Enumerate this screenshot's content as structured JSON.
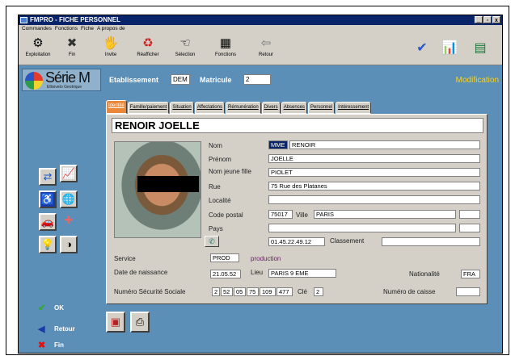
{
  "window": {
    "title": "FMPRO - FICHE PERSONNEL",
    "controls": [
      "_",
      "▫",
      "x"
    ]
  },
  "menu": [
    "Commandes",
    "Fonctions",
    "Fiche",
    "A propos de"
  ],
  "toolbar": {
    "buttons": [
      {
        "label": "Exploitation",
        "icon": "exploitation-icon",
        "glyph": "⚙"
      },
      {
        "label": "Fin",
        "icon": "fin-icon",
        "glyph": "✖"
      },
      {
        "label": "Invite",
        "icon": "invite-icon",
        "glyph": "🖐"
      },
      {
        "label": "Réafficher",
        "icon": "refresh-icon",
        "glyph": "♻"
      },
      {
        "label": "Sélection",
        "icon": "selection-icon",
        "glyph": "☜"
      },
      {
        "label": "Fonctions",
        "icon": "functions-icon",
        "glyph": "▦"
      },
      {
        "label": "Retour",
        "icon": "back-icon",
        "glyph": "⇦"
      }
    ],
    "right_icons": [
      {
        "icon": "check-tool-icon",
        "glyph": "✔"
      },
      {
        "icon": "presentation-icon",
        "glyph": "📊"
      },
      {
        "icon": "calculator-icon",
        "glyph": "▤"
      }
    ]
  },
  "header": {
    "app_title": "Série M",
    "app_subtitle": "Ellisiveto Geotrique",
    "etablissement_label": "Etablissement",
    "etablissement_value": "DEM",
    "matricule_label": "Matricule",
    "matricule_value": "2",
    "mode": "Modification"
  },
  "side": {
    "grid_icons": [
      "person-transfer-icon",
      "chart-icon",
      "accessibility-icon",
      "globe-icon",
      "car-icon",
      "medical-cross-icon",
      "lightbulb-icon",
      "pie-icon"
    ],
    "grid_glyphs": [
      "⇄",
      "📈",
      "♿",
      "🌐",
      "🚗",
      "✚",
      "💡",
      "◑"
    ],
    "nav": [
      {
        "label": "OK",
        "glyph": "✔",
        "color": "#2eaa2e"
      },
      {
        "label": "Retour",
        "glyph": "◀",
        "color": "#1a3aa8"
      },
      {
        "label": "Fin",
        "glyph": "✖",
        "color": "#e01010"
      }
    ]
  },
  "tabs": [
    "Identité",
    "Famille/paiement",
    "Situation",
    "Affectations",
    "Rémunération",
    "Divers",
    "Absences",
    "Personnel",
    "Intéressement"
  ],
  "fiche": {
    "full_name": "RENOIR JOELLE",
    "labels": {
      "nom": "Nom",
      "prenom": "Prénom",
      "nom_jeune_fille": "Nom jeune fille",
      "rue": "Rue",
      "localite": "Localité",
      "code_postal": "Code postal",
      "ville": "Ville",
      "pays": "Pays",
      "classement": "Classement",
      "service": "Service",
      "date_naissance": "Date de naissance",
      "lieu": "Lieu",
      "nationalite": "Nationalité",
      "nss": "Numéro Sécurité Sociale",
      "cle": "Clé",
      "caisse": "Numéro de caisse"
    },
    "civilite": "MME",
    "nom": "RENOIR",
    "prenom": "JOELLE",
    "nom_jeune_fille": "PIOLET",
    "rue": "75 Rue des Platanes",
    "localite": "",
    "code_postal": "75017",
    "ville": "PARIS",
    "pays": "",
    "telephone": "01.45.22.49.12",
    "classement": "",
    "service_code": "PROD",
    "service_label": "production",
    "date_naissance": "21.05.52",
    "lieu": "PARIS 9 EME",
    "nationalite": "FRA",
    "nss": [
      "2",
      "52",
      "05",
      "75",
      "109",
      "477"
    ],
    "cle": "2",
    "caisse": ""
  }
}
